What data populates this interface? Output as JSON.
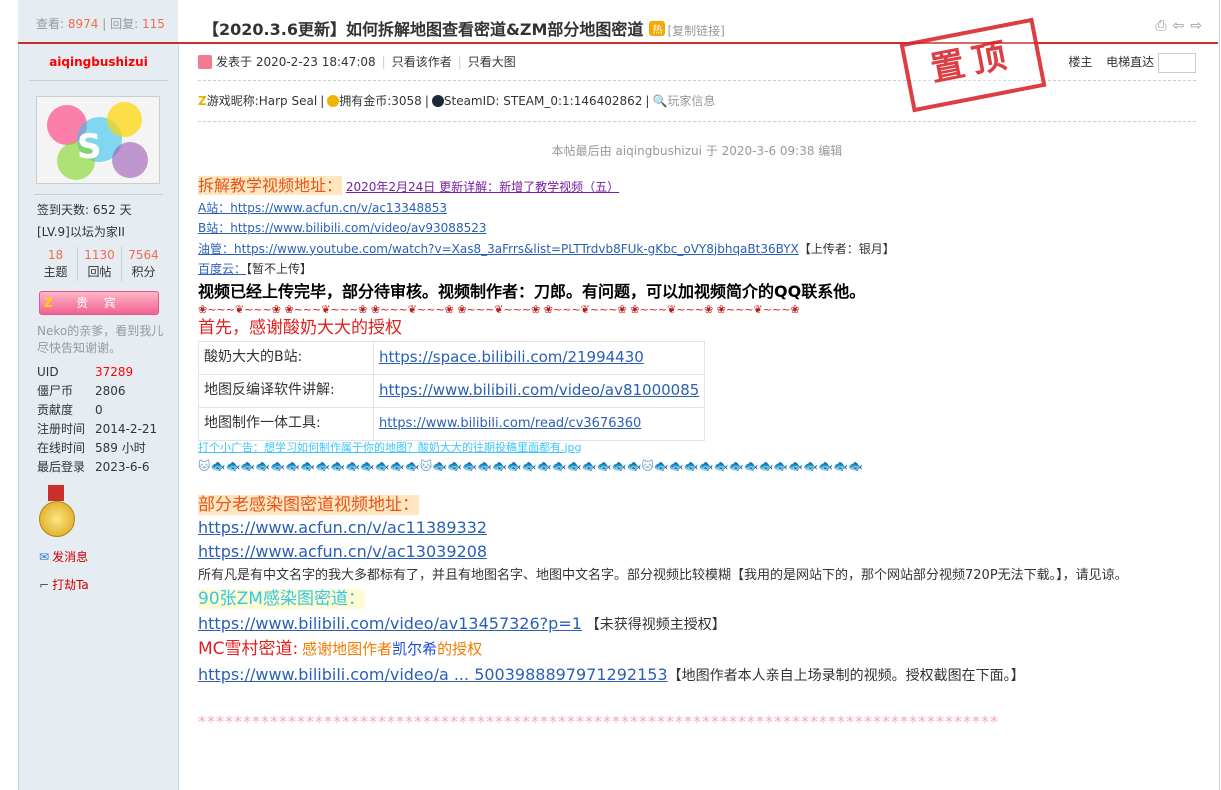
{
  "stats": {
    "view_label": "查看:",
    "views": "8974",
    "sep": "|",
    "reply_label": "回复:",
    "replies": "115"
  },
  "thread": {
    "title": "【2020.3.6更新】如何拆解地图查看密道&ZM部分地图密道",
    "badge": "热",
    "copy_link": "[复制链接]"
  },
  "top_icons": {
    "print": "⎙",
    "prev": "⇦",
    "next": "⇨"
  },
  "author": {
    "name": "aiqingbushizui",
    "avatar_caption": "S",
    "signin": "签到天数: 652 天",
    "level": "[LV.9]以坛为家II",
    "counts": [
      {
        "num": "18",
        "label": "主题"
      },
      {
        "num": "1130",
        "label": "回帖"
      },
      {
        "num": "7564",
        "label": "积分"
      }
    ],
    "group": "贵 宾",
    "group_mark": "Z",
    "intro": "Neko的亲爹，看到我儿尽快告知谢谢。",
    "info": [
      {
        "k": "UID",
        "v": "37289"
      },
      {
        "k": "僵尸币",
        "v": "2806"
      },
      {
        "k": "贡献度",
        "v": "0"
      },
      {
        "k": "注册时间",
        "v": "2014-2-21"
      },
      {
        "k": "在线时间",
        "v": "589 小时"
      },
      {
        "k": "最后登录",
        "v": "2023-6-6"
      }
    ],
    "send_msg": "发消息",
    "rob": "打劫Ta"
  },
  "post": {
    "posted": "发表于 2020-2-23 18:47:08",
    "only_author": "只看该作者",
    "only_img": "只看大图",
    "floor": "楼主",
    "jump": "电梯直达",
    "stamp": "置顶",
    "extra": {
      "nick_mark": "Z",
      "nick": "游戏昵称:Harp Seal",
      "gold": "拥有金币:3058",
      "steam": "SteamID: STEAM_0:1:146402862",
      "playerinfo": "玩家信息"
    },
    "edited": "本帖最后由 aiqingbushizui 于 2020-3-6 09:38 编辑",
    "video_title": "拆解教学视频地址：",
    "video_update": "2020年2月24日 更新详解：新增了教学视频（五）",
    "acfun_label": "A站：",
    "acfun_url": "https://www.acfun.cn/v/ac13348853",
    "bili_label": "B站：",
    "bili_url": "https://www.bilibili.com/video/av93088523",
    "yt_label": "油管：",
    "yt_url": "https://www.youtube.com/watch?v=Xas8_3aFrrs&list=PLTTrdvb8FUk-gKbc_oVY8jbhqaBt36BYX",
    "yt_uploader": "【上传者：银月】",
    "baidu_label": "百度云：",
    "baidu_note": "【暂不上传】",
    "bold_line": "视频已经上传完毕，部分待审核。视频制作者：刀郎。有问题，可以加视频简介的QQ联系他。",
    "roses": "❀~~~❦~~~❀ ❀~~~❦~~~❀ ❀~~~❦~~~❀ ❀~~~❦~~~❀ ❀~~~❦~~~❀ ❀~~~❦~~~❀ ❀~~~❦~~~❀",
    "thanks": "首先，感谢酸奶大大的授权",
    "table": [
      {
        "k": "酸奶大大的B站:",
        "v": "https://space.bilibili.com/21994430"
      },
      {
        "k": "地图反编译软件讲解:",
        "v": "https://www.bilibili.com/video/av81000085"
      },
      {
        "k": "地图制作一体工具:",
        "v": "https://www.bilibili.com/read/cv3676360"
      }
    ],
    "ad": "打个小广告：想学习如何制作属于你的地图？酸奶大大的往期投稿里面都有.jpg",
    "fish": "🐱🐟🐟🐟🐟🐟🐟🐟🐟🐟🐟🐟🐟🐟🐟🐱🐟🐟🐟🐟🐟🐟🐟🐟🐟🐟🐟🐟🐟🐟🐱🐟🐟🐟🐟🐟🐟🐟🐟🐟🐟🐟🐟🐟🐟",
    "old_title": "部分老感染图密道视频地址：",
    "old_url1": "https://www.acfun.cn/v/ac11389332",
    "old_url2": "https://www.acfun.cn/v/ac13039208",
    "old_note": "所有凡是有中文名字的我大多都标有了，并且有地图名字、地图中文名字。部分视频比较模糊【我用的是网站下的，那个网站部分视频720P无法下载。】，请见谅。",
    "zm_title": "90张ZM感染图密道：",
    "zm_url": "https://www.bilibili.com/video/av13457326?p=1",
    "zm_note": "【未获得视频主授权】",
    "mc_title": "MC雪村密道:",
    "mc_thanks_pre": "感谢地图作者",
    "mc_author": "凯尔希",
    "mc_thanks_post": "的授权",
    "mc_url": "https://www.bilibili.com/video/a ... 5003988897971292153",
    "mc_note": "【地图作者本人亲自上场录制的视频。授权截图在下面。】",
    "stars": "*****************************************************************************************"
  }
}
